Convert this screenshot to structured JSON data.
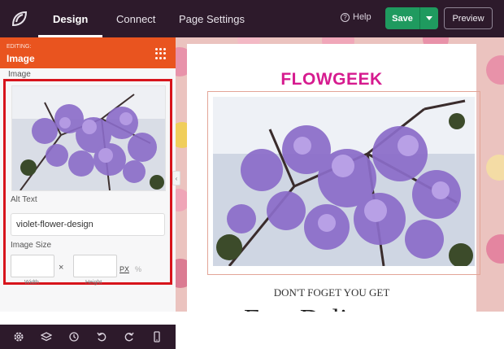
{
  "topbar": {
    "tabs": [
      "Design",
      "Connect",
      "Page Settings"
    ],
    "help_label": "Help",
    "save_label": "Save",
    "preview_label": "Preview"
  },
  "sidebar": {
    "editing_caption": "EDITING:",
    "editing_title": "Image",
    "image_label": "Image",
    "alt_text_label": "Alt Text",
    "alt_text_value": "violet-flower-design",
    "image_size_label": "Image Size",
    "width_caption": "Width",
    "height_caption": "Height",
    "times_symbol": "×",
    "unit_px": "PX",
    "unit_percent": "%"
  },
  "canvas": {
    "brand_title": "FLOWGEEK",
    "tagline": "DON'T FOGET YOU GET",
    "heading_partial": "Free Deli"
  },
  "colors": {
    "topbar": "#2d1a2b",
    "editing_header": "#e9541f",
    "highlight_border": "#d7141c",
    "save": "#1f9a5f",
    "brand": "#d61b8f"
  }
}
